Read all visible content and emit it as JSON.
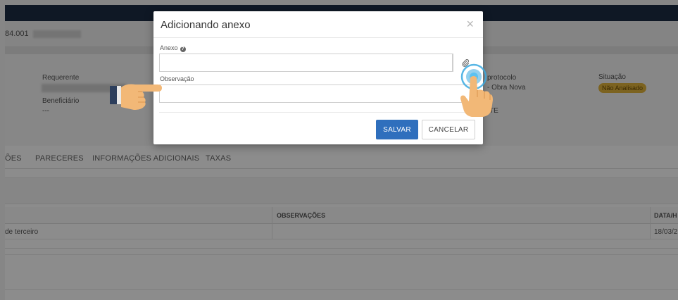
{
  "page": {
    "process_number": "84.001",
    "requerente_label": "Requerente",
    "beneficiario_label": "Beneficiário",
    "beneficiario_value": "---",
    "protocolo_label": "protocolo",
    "tipo_value": "- Obra Nova",
    "extra_value": "TE",
    "situacao_label": "Situação",
    "situacao_badge": "Não Analisado",
    "tabs": [
      {
        "label": "ÕES"
      },
      {
        "label": "PARECERES"
      },
      {
        "label": "INFORMAÇÕES ADICIONAIS"
      },
      {
        "label": "TAXAS"
      }
    ],
    "table": {
      "col_observacoes": "OBSERVAÇÕES",
      "col_data": "DATA/H",
      "row_desc": "de terceiro",
      "row_date": "18/03/2"
    }
  },
  "modal": {
    "title": "Adicionando anexo",
    "close_symbol": "×",
    "anexo_label": "Anexo",
    "help_symbol": "?",
    "anexo_value": "",
    "observacao_label": "Observação",
    "observacao_value": "",
    "save_label": "SALVAR",
    "cancel_label": "CANCELAR"
  },
  "icons": {
    "attach": "paperclip-icon",
    "help": "question-icon",
    "close": "close-icon"
  },
  "colors": {
    "primary": "#2f6fbd",
    "badge": "#e2b43b",
    "topbar": "#1c2d44",
    "hand": "#f2b877"
  }
}
